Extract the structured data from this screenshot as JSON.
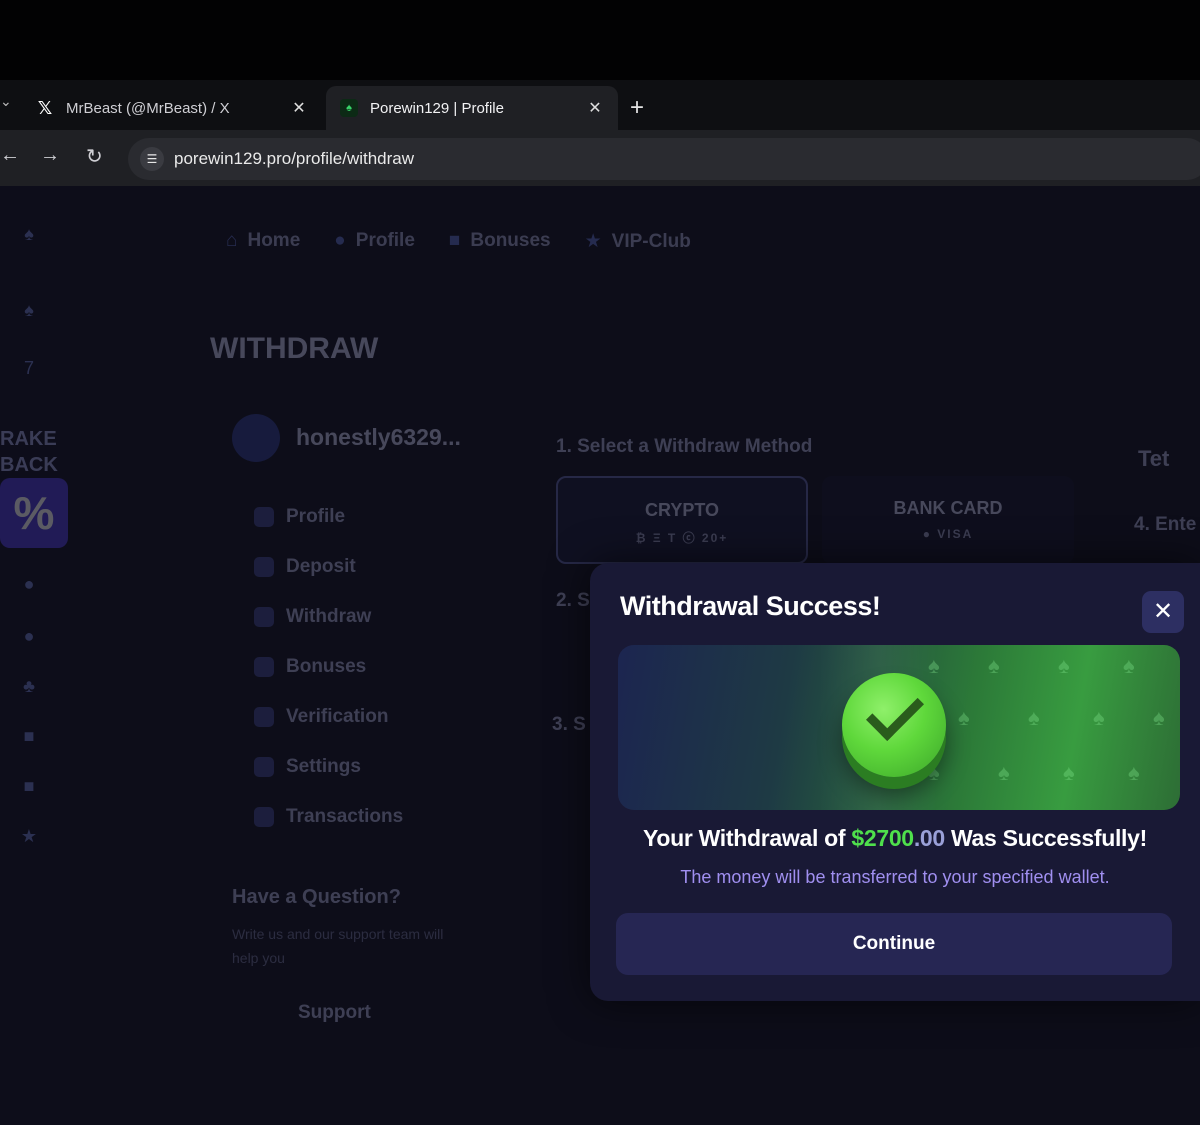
{
  "browser": {
    "tabs": [
      {
        "title": "MrBeast (@MrBeast) / X",
        "icon": "x-logo-icon",
        "active": false
      },
      {
        "title": "Porewin129 | Profile",
        "icon": "porewin-logo-icon",
        "active": true
      }
    ],
    "close_glyph": "✕",
    "new_tab_glyph": "+",
    "url": "porewin129.pro/profile/withdraw"
  },
  "page": {
    "top_nav": [
      "Home",
      "Profile",
      "Bonuses",
      "VIP-Club"
    ],
    "heading": "WITHDRAW",
    "rakeback": {
      "line1": "RAKE",
      "line2": "BACK",
      "badge": "%"
    },
    "username": "honestly6329...",
    "menu": [
      "Profile",
      "Deposit",
      "Withdraw",
      "Bonuses",
      "Verification",
      "Settings",
      "Transactions"
    ],
    "question": {
      "title": "Have a Question?",
      "text": "Write us and our support team will help you",
      "support_label": "Support"
    },
    "steps": {
      "step1": "1. Select a Withdraw Method",
      "step2": "2. S",
      "step3": "3. S",
      "step4": "4. Ente"
    },
    "methods": [
      {
        "label": "CRYPTO",
        "sub": "₿ Ξ T ⓒ  20+"
      },
      {
        "label": "BANK CARD",
        "sub": "● VISA"
      }
    ],
    "tether_label": "Tet"
  },
  "modal": {
    "title": "Withdrawal Success!",
    "close_glyph": "✕",
    "message_prefix": "Your Withdrawal of ",
    "amount_main": "$2700",
    "amount_cents": ".00",
    "message_suffix": " Was Successfully!",
    "info": "The money will be transferred to your specified wallet.",
    "continue_label": "Continue"
  },
  "colors": {
    "accent_green": "#4fe04c",
    "info_purple": "#a08ff0",
    "modal_bg": "#191935",
    "button_bg": "#262653"
  }
}
